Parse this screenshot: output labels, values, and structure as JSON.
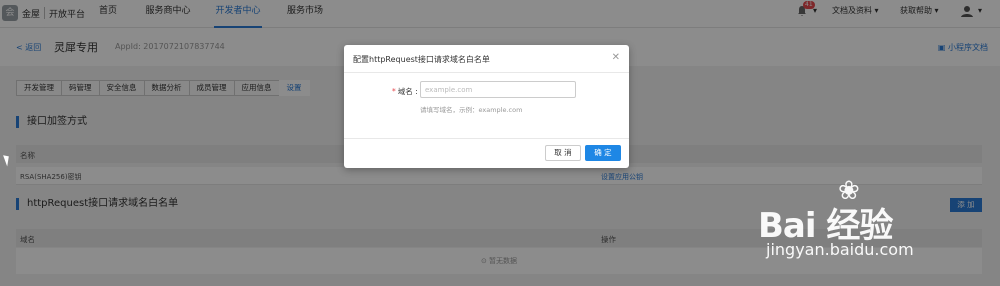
{
  "topnav": {
    "logo_mark": "会",
    "logo_text": "金屋",
    "logo_sub": "开放平台",
    "items": [
      {
        "label": "首页"
      },
      {
        "label": "服务商中心"
      },
      {
        "label": "开发者中心"
      },
      {
        "label": "服务市场"
      }
    ],
    "notification_count": "41",
    "right_items": [
      {
        "label": "文档及资料 ▾"
      },
      {
        "label": "获取帮助 ▾"
      }
    ],
    "accent": "#2a7ad5"
  },
  "subhead": {
    "back_label": "< 返回",
    "app_title": "灵犀专用",
    "app_id": "AppId: 2017072107837744",
    "doc_link": "小程序文档"
  },
  "tabs": [
    {
      "label": "开发管理"
    },
    {
      "label": "码管理"
    },
    {
      "label": "安全信息"
    },
    {
      "label": "数据分析"
    },
    {
      "label": "成员管理"
    },
    {
      "label": "应用信息"
    },
    {
      "label": "设置"
    }
  ],
  "section1": {
    "title": "接口加签方式",
    "col_name": "名称",
    "row_name": "RSA(SHA256)密钥",
    "row_action": "设置应用公钥"
  },
  "section2": {
    "title": "httpRequest接口请求域名白名单",
    "add_label": "添 加",
    "col_domain": "域名",
    "col_action": "操作",
    "empty_text": "暂无数据"
  },
  "modal": {
    "title": "配置httpRequest接口请求域名白名单",
    "close_icon": "close-icon",
    "field_label": "域名 :",
    "field_placeholder": "example.com",
    "field_hint": "请填写域名，示例：example.com",
    "cancel_label": "取 消",
    "ok_label": "确 定"
  },
  "watermark": {
    "brand": "Bai 经验",
    "url": "jingyan.baidu.com"
  }
}
